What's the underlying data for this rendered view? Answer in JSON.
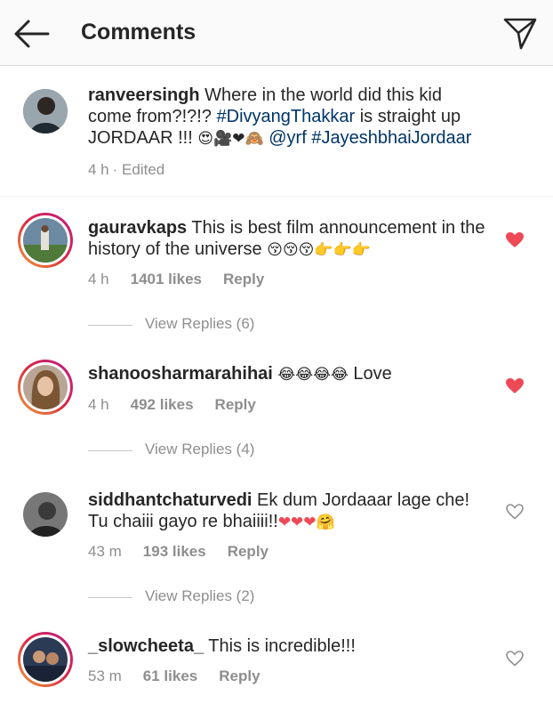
{
  "header": {
    "title": "Comments",
    "back_icon": "arrow-left-icon",
    "send_icon": "paper-plane-icon"
  },
  "caption": {
    "username": "ranveersingh",
    "text_1": "Where in the world did this kid come from?!?!? ",
    "hashtag_1": "#DivyangThakkar",
    "text_2": " is straight up JORDAAR !!! ",
    "emojis": "😍🎥❤🙈",
    "mention": "@yrf",
    "hashtag_2": "#JayeshbhaiJordaar",
    "time": "4 h",
    "edited": "· Edited"
  },
  "comments": [
    {
      "username": "gauravkaps",
      "text": "This is best film announcement in the history of the universe ",
      "emojis": "😚😚😚👉👉👉",
      "time": "4 h",
      "likes": "1401 likes",
      "reply": "Reply",
      "liked": true,
      "view_replies": "View Replies (6)"
    },
    {
      "username": "shanoosharmarahihai",
      "text": " Love",
      "emojis": "😂😂😂😂",
      "time": "4 h",
      "likes": "492 likes",
      "reply": "Reply",
      "liked": true,
      "view_replies": "View Replies (4)"
    },
    {
      "username": "siddhantchaturvedi",
      "text": "Ek dum Jordaaar lage che! Tu chaiii gayo re bhaiiii!!",
      "emojis": "❤❤❤🤗",
      "time": "43 m",
      "likes": "193 likes",
      "reply": "Reply",
      "liked": false,
      "view_replies": "View Replies (2)"
    },
    {
      "username": "_slowcheeta_",
      "text": "This is incredible!!!",
      "emojis": "",
      "time": "53 m",
      "likes": "61 likes",
      "reply": "Reply",
      "liked": false
    }
  ],
  "colors": {
    "liked_heart": "#ed4956",
    "hashtag": "#003569",
    "meta": "#8e8e8e"
  }
}
